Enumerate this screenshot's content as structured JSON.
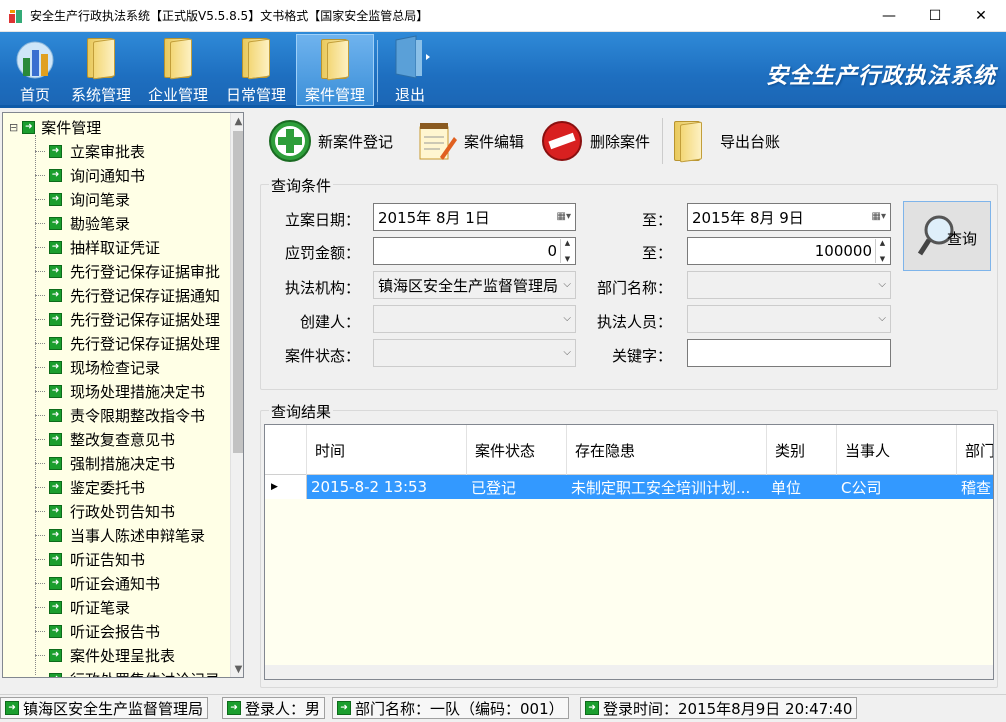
{
  "window": {
    "title": "安全生产行政执法系统【正式版V5.5.8.5】文书格式【国家安全监管总局】",
    "minimize": "—",
    "maximize": "☐",
    "close": "✕"
  },
  "ribbon": {
    "items": [
      {
        "label": "首页",
        "icon": "chart-icon"
      },
      {
        "label": "系统管理",
        "icon": "folder-icon"
      },
      {
        "label": "企业管理",
        "icon": "folder-icon"
      },
      {
        "label": "日常管理",
        "icon": "folder-icon"
      },
      {
        "label": "案件管理",
        "icon": "folder-icon",
        "active": true
      },
      {
        "label": "退出",
        "icon": "exit-door-icon"
      }
    ],
    "app_title": "安全生产行政执法系统"
  },
  "tree": {
    "root": "案件管理",
    "toggle": "⊟",
    "items": [
      "立案审批表",
      "询问通知书",
      "询问笔录",
      "勘验笔录",
      "抽样取证凭证",
      "先行登记保存证据审批",
      "先行登记保存证据通知",
      "先行登记保存证据处理",
      "先行登记保存证据处理",
      "现场检查记录",
      "现场处理措施决定书",
      "责令限期整改指令书",
      "整改复查意见书",
      "强制措施决定书",
      "鉴定委托书",
      "行政处罚告知书",
      "当事人陈述申辩笔录",
      "听证告知书",
      "听证会通知书",
      "听证笔录",
      "听证会报告书",
      "案件处理呈批表",
      "行政处罚集体讨论记录"
    ]
  },
  "toolbar": {
    "new_case": "新案件登记",
    "edit_case": "案件编辑",
    "delete_case": "删除案件",
    "export": "导出台账"
  },
  "query": {
    "group_title": "查询条件",
    "date_label": "立案日期：",
    "date_from": "2015年  8月  1日",
    "to_label": "至：",
    "date_to": "2015年  8月  9日",
    "fine_label": "应罚金额：",
    "fine_from": "0",
    "fine_to": "100000",
    "agency_label": "执法机构：",
    "agency_value": "镇海区安全生产监督管理局",
    "dept_label": "部门名称：",
    "dept_value": "",
    "creator_label": "创建人：",
    "creator_value": "",
    "officer_label": "执法人员：",
    "officer_value": "",
    "status_label": "案件状态：",
    "status_value": "",
    "keyword_label": "关键字：",
    "keyword_value": "",
    "search_button": "查询"
  },
  "results": {
    "group_title": "查询结果",
    "columns": [
      "时间",
      "案件状态",
      "存在隐患",
      "类别",
      "当事人",
      "部门"
    ],
    "rows": [
      [
        "2015-8-2 13:53",
        "已登记",
        "未制定职工安全培训计划...",
        "单位",
        "C公司",
        "稽查"
      ]
    ]
  },
  "statusbar": {
    "agency": "镇海区安全生产监督管理局",
    "user": "登录人：男",
    "dept": "部门名称：一队（编码：001）",
    "login_time": "登录时间：2015年8月9日 20:47:40"
  }
}
